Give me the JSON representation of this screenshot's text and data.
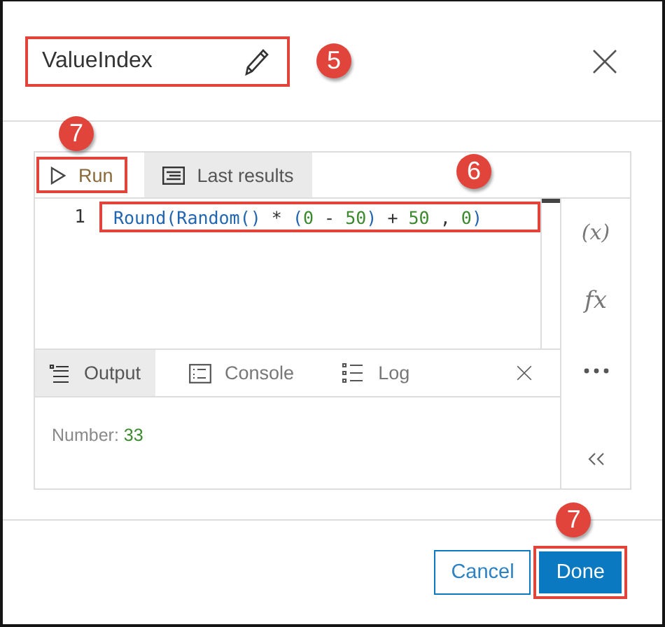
{
  "title": {
    "text": "ValueIndex",
    "highlighted": true,
    "callout": "5"
  },
  "toolbar": [
    {
      "kind": "run",
      "label": "Run",
      "selected": false,
      "highlighted": true,
      "callout": "7"
    },
    {
      "kind": "results",
      "label": "Last results",
      "selected": true,
      "highlighted": false
    }
  ],
  "code": {
    "line_number": "1",
    "highlighted": true,
    "callout": "6",
    "tokens": [
      {
        "kind": "function",
        "text": "Round"
      },
      {
        "kind": "punct",
        "text": "("
      },
      {
        "kind": "function",
        "text": "Random"
      },
      {
        "kind": "punct",
        "text": "()"
      },
      {
        "kind": "operator",
        "text": " * "
      },
      {
        "kind": "punct",
        "text": "("
      },
      {
        "kind": "number",
        "text": "0"
      },
      {
        "kind": "operator",
        "text": " - "
      },
      {
        "kind": "number",
        "text": "50"
      },
      {
        "kind": "punct",
        "text": ")"
      },
      {
        "kind": "operator",
        "text": " + "
      },
      {
        "kind": "number",
        "text": "50"
      },
      {
        "kind": "operator",
        "text": " , "
      },
      {
        "kind": "number",
        "text": "0"
      },
      {
        "kind": "punct",
        "text": ")"
      }
    ]
  },
  "side_tools": [
    {
      "kind": "variables",
      "label": "(x)"
    },
    {
      "kind": "functions",
      "label": "fx"
    },
    {
      "kind": "more"
    },
    {
      "kind": "collapse"
    }
  ],
  "output_tabs": [
    {
      "kind": "output",
      "label": "Output",
      "selected": true
    },
    {
      "kind": "console",
      "label": "Console",
      "selected": false
    },
    {
      "kind": "log",
      "label": "Log",
      "selected": false
    }
  ],
  "output": {
    "label": "Number:",
    "value": "33"
  },
  "buttons": [
    {
      "kind": "secondary",
      "label": "Cancel",
      "highlighted": false
    },
    {
      "kind": "primary",
      "label": "Done",
      "highlighted": true,
      "callout": "7"
    }
  ]
}
